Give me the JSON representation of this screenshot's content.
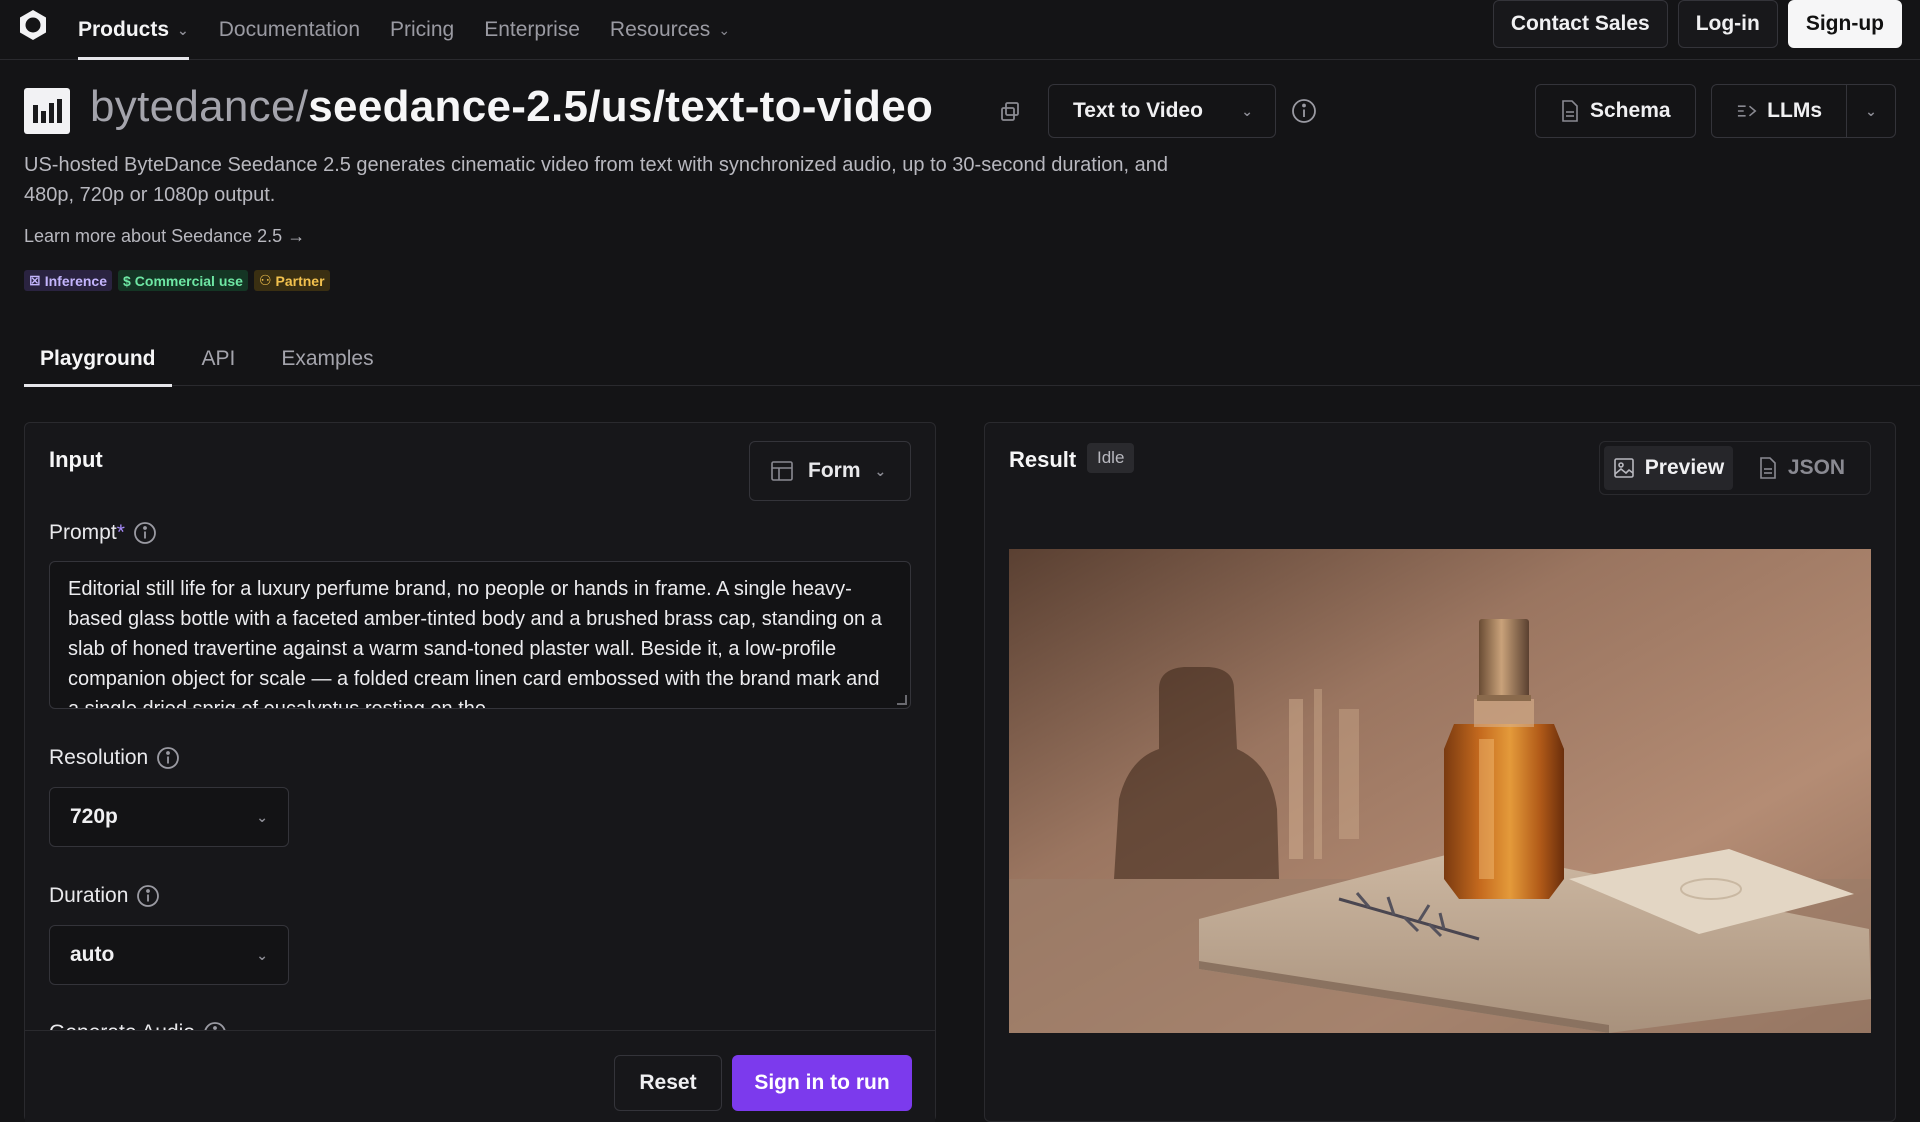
{
  "nav": {
    "items": [
      {
        "label": "Products",
        "has_menu": true,
        "active": true
      },
      {
        "label": "Documentation"
      },
      {
        "label": "Pricing"
      },
      {
        "label": "Enterprise"
      },
      {
        "label": "Resources",
        "has_menu": true
      }
    ],
    "contact_sales": "Contact Sales",
    "login": "Log-in",
    "signup": "Sign-up"
  },
  "model": {
    "owner": "bytedance/",
    "slug": "seedance-2.5/us/text-to-video",
    "mode": "Text to Video",
    "schema_label": "Schema",
    "llms_label": "LLMs",
    "description": "US-hosted ByteDance Seedance 2.5 generates cinematic video from text with synchronized audio, up to 30-second duration, and 480p, 720p or 1080p output.",
    "learn_more": "Learn more about Seedance 2.5 →",
    "badges": {
      "inference": "Inference",
      "commercial": "Commercial use",
      "partner": "Partner"
    }
  },
  "tabs": {
    "playground": "Playground",
    "api": "API",
    "examples": "Examples"
  },
  "input": {
    "title": "Input",
    "form_label": "Form",
    "prompt_label": "Prompt",
    "prompt_required": "*",
    "prompt_value": "Editorial still life for a luxury perfume brand, no people or hands in frame. A single heavy-based glass bottle with a faceted amber-tinted body and a brushed brass cap, standing on a slab of honed travertine against a warm sand-toned plaster wall. Beside it, a low-profile companion object for scale — a folded cream linen card embossed with the brand mark and a single dried sprig of eucalyptus resting on the",
    "resolution_label": "Resolution",
    "resolution_value": "720p",
    "duration_label": "Duration",
    "duration_value": "auto",
    "audio_label": "Generate Audio",
    "reset_label": "Reset",
    "run_label": "Sign in to run"
  },
  "result": {
    "title": "Result",
    "status": "Idle",
    "preview_label": "Preview",
    "json_label": "JSON"
  },
  "colors": {
    "accent": "#7c3aed",
    "background": "#141416",
    "panel": "#17171a",
    "border": "#2a2a2e"
  }
}
